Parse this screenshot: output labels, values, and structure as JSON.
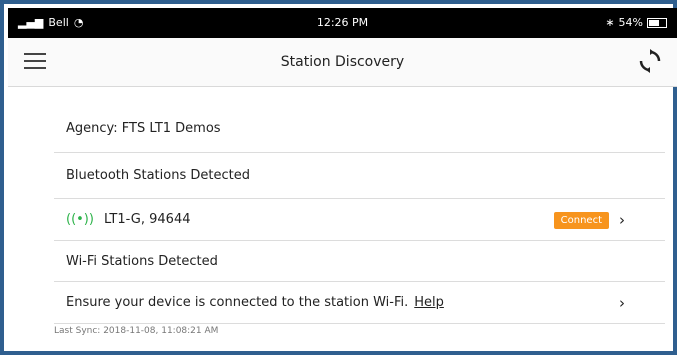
{
  "status_bar": {
    "carrier": "Bell",
    "time": "12:26 PM",
    "battery": "54%"
  },
  "header": {
    "title": "Station Discovery"
  },
  "agency": {
    "label": "Agency: FTS LT1 Demos"
  },
  "bluetooth": {
    "section_title": "Bluetooth Stations Detected",
    "station_name": "LT1-G, 94644",
    "connect_label": "Connect"
  },
  "wifi": {
    "section_title": "Wi-Fi Stations Detected",
    "note": "Ensure your device is connected to the station Wi-Fi.",
    "help_label": "Help"
  },
  "footer": {
    "last_sync": "Last Sync: 2018-11-08, 11:08:21 AM"
  },
  "icons": {
    "menu": "hamburger-icon",
    "refresh": "refresh-icon",
    "signal": "bluetooth-signal-icon",
    "chevron": "chevron-right-icon"
  }
}
